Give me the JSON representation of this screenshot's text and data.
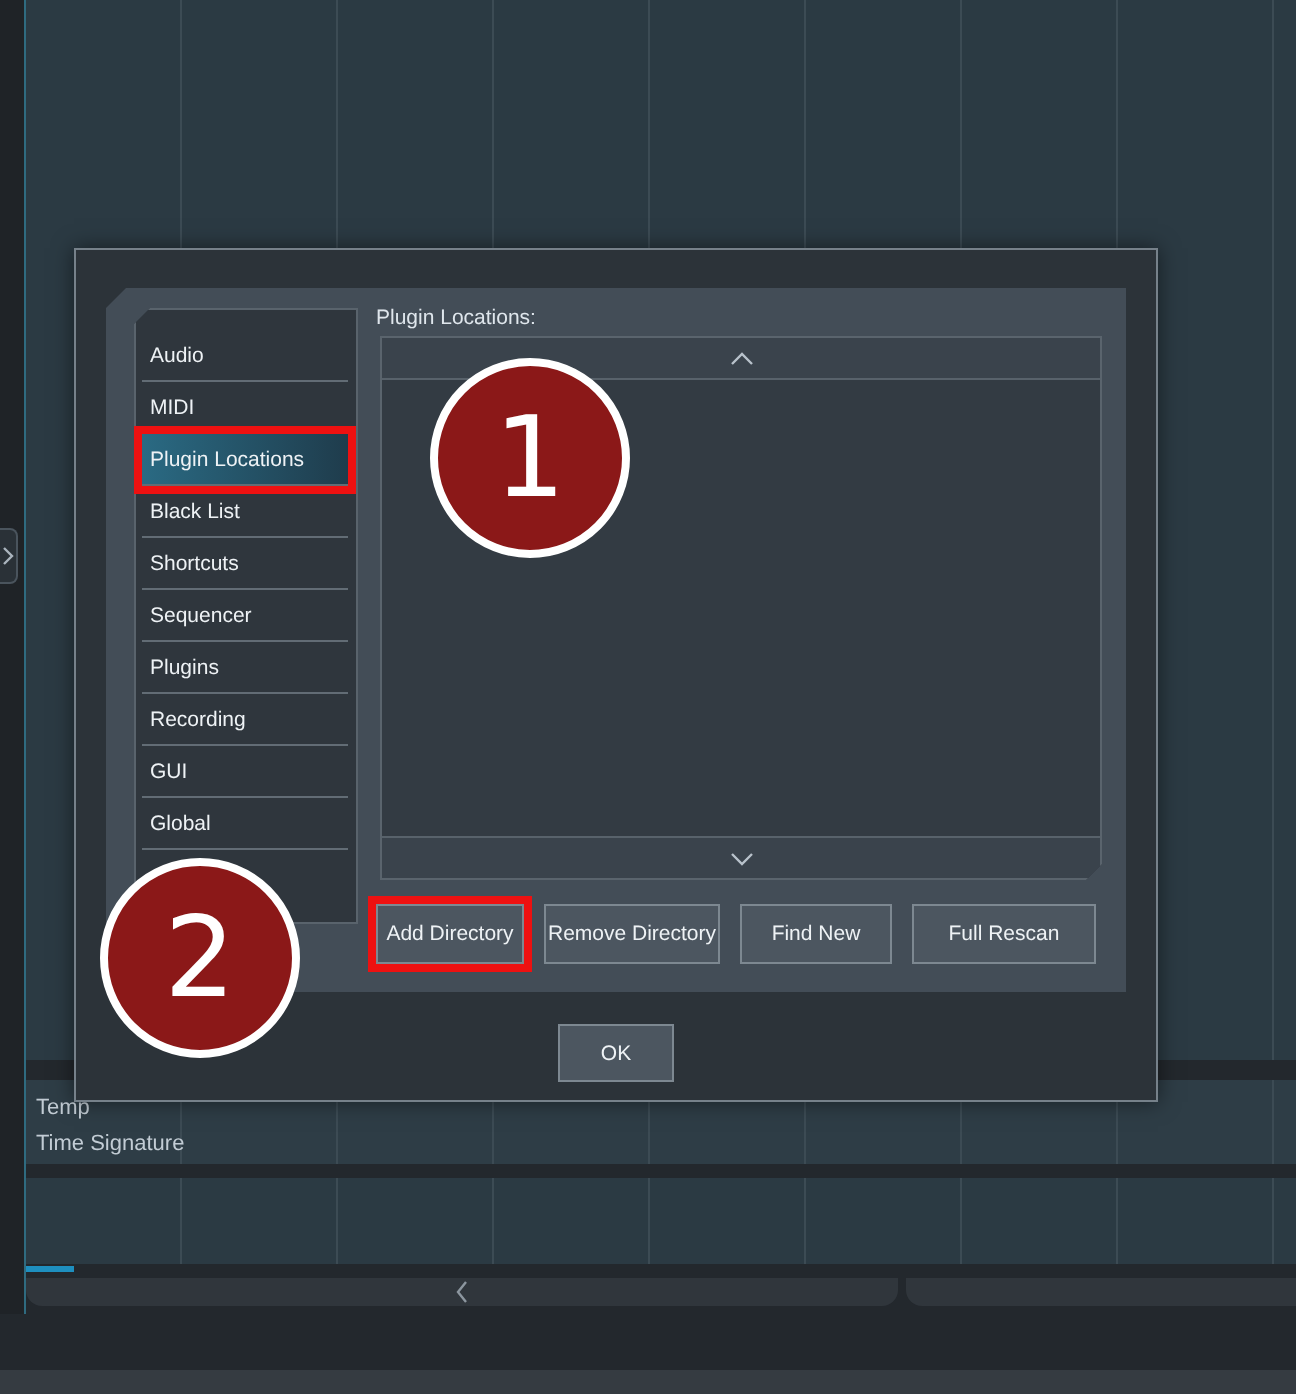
{
  "tracks": [
    {
      "name": "Temp"
    },
    {
      "name": "Time Signature"
    }
  ],
  "dialog": {
    "sidebar": {
      "items": [
        {
          "label": "Audio",
          "selected": false,
          "highlighted": false
        },
        {
          "label": "MIDI",
          "selected": false,
          "highlighted": false
        },
        {
          "label": "Plugin Locations",
          "selected": true,
          "highlighted": true
        },
        {
          "label": "Black List",
          "selected": false,
          "highlighted": false
        },
        {
          "label": "Shortcuts",
          "selected": false,
          "highlighted": false
        },
        {
          "label": "Sequencer",
          "selected": false,
          "highlighted": false
        },
        {
          "label": "Plugins",
          "selected": false,
          "highlighted": false
        },
        {
          "label": "Recording",
          "selected": false,
          "highlighted": false
        },
        {
          "label": "GUI",
          "selected": false,
          "highlighted": false
        },
        {
          "label": "Global",
          "selected": false,
          "highlighted": false
        }
      ]
    },
    "section_title": "Plugin Locations:",
    "buttons": [
      {
        "label": "Add Directory",
        "highlighted": true
      },
      {
        "label": "Remove Directory",
        "highlighted": false
      },
      {
        "label": "Find New",
        "highlighted": false
      },
      {
        "label": "Full Rescan",
        "highlighted": false
      }
    ],
    "ok_button": "OK"
  },
  "callouts": [
    {
      "number": "1"
    },
    {
      "number": "2"
    }
  ]
}
